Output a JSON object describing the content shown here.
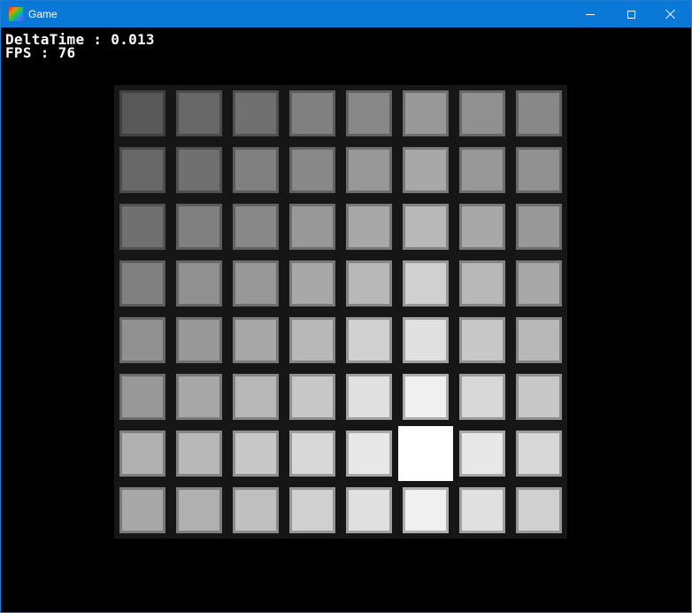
{
  "window": {
    "title": "Game",
    "icon": "app-icon",
    "titlebar_color": "#0a78d7"
  },
  "hud": {
    "delta_label": "DeltaTime : ",
    "delta_value": "0.013",
    "fps_label": "FPS : ",
    "fps_value": "76"
  },
  "board": {
    "rows": 8,
    "cols": 8,
    "selected": {
      "row": 6,
      "col": 5
    },
    "tile_levels": [
      [
        88,
        104,
        112,
        128,
        136,
        152,
        144,
        136
      ],
      [
        104,
        112,
        128,
        136,
        152,
        168,
        152,
        144
      ],
      [
        112,
        128,
        136,
        152,
        168,
        184,
        168,
        152
      ],
      [
        128,
        144,
        152,
        168,
        184,
        208,
        184,
        168
      ],
      [
        144,
        152,
        168,
        184,
        208,
        224,
        200,
        184
      ],
      [
        152,
        168,
        184,
        200,
        224,
        240,
        216,
        200
      ],
      [
        176,
        184,
        200,
        216,
        232,
        255,
        232,
        216
      ],
      [
        168,
        176,
        192,
        208,
        224,
        240,
        224,
        208
      ]
    ]
  }
}
